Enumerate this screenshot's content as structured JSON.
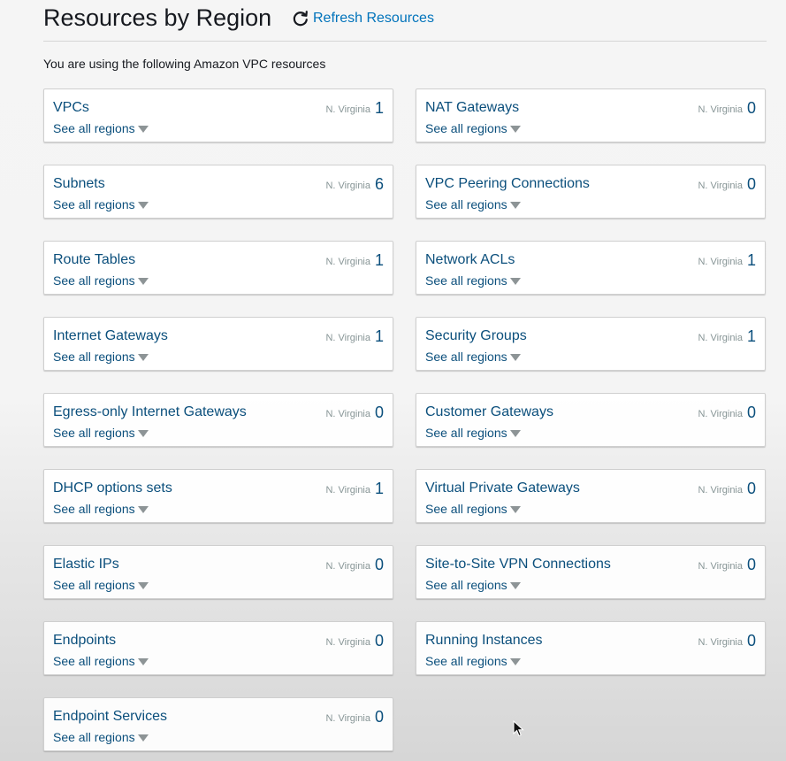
{
  "header": {
    "title": "Resources by Region",
    "refresh_label": "Refresh Resources",
    "refresh_icon": "refresh-icon"
  },
  "intro": "You are using the following Amazon VPC resources",
  "colors": {
    "link": "#0b4f7c",
    "accent_link": "#0073bb",
    "muted": "#879596"
  },
  "resources": [
    {
      "name": "VPCs",
      "region": "N. Virginia",
      "count": "1",
      "see_all": "See all regions"
    },
    {
      "name": "NAT Gateways",
      "region": "N. Virginia",
      "count": "0",
      "see_all": "See all regions"
    },
    {
      "name": "Subnets",
      "region": "N. Virginia",
      "count": "6",
      "see_all": "See all regions"
    },
    {
      "name": "VPC Peering Connections",
      "region": "N. Virginia",
      "count": "0",
      "see_all": "See all regions"
    },
    {
      "name": "Route Tables",
      "region": "N. Virginia",
      "count": "1",
      "see_all": "See all regions"
    },
    {
      "name": "Network ACLs",
      "region": "N. Virginia",
      "count": "1",
      "see_all": "See all regions"
    },
    {
      "name": "Internet Gateways",
      "region": "N. Virginia",
      "count": "1",
      "see_all": "See all regions"
    },
    {
      "name": "Security Groups",
      "region": "N. Virginia",
      "count": "1",
      "see_all": "See all regions"
    },
    {
      "name": "Egress-only Internet Gateways",
      "region": "N. Virginia",
      "count": "0",
      "see_all": "See all regions"
    },
    {
      "name": "Customer Gateways",
      "region": "N. Virginia",
      "count": "0",
      "see_all": "See all regions"
    },
    {
      "name": "DHCP options sets",
      "region": "N. Virginia",
      "count": "1",
      "see_all": "See all regions"
    },
    {
      "name": "Virtual Private Gateways",
      "region": "N. Virginia",
      "count": "0",
      "see_all": "See all regions"
    },
    {
      "name": "Elastic IPs",
      "region": "N. Virginia",
      "count": "0",
      "see_all": "See all regions"
    },
    {
      "name": "Site-to-Site VPN Connections",
      "region": "N. Virginia",
      "count": "0",
      "see_all": "See all regions"
    },
    {
      "name": "Endpoints",
      "region": "N. Virginia",
      "count": "0",
      "see_all": "See all regions"
    },
    {
      "name": "Running Instances",
      "region": "N. Virginia",
      "count": "0",
      "see_all": "See all regions"
    },
    {
      "name": "Endpoint Services",
      "region": "N. Virginia",
      "count": "0",
      "see_all": "See all regions"
    }
  ]
}
